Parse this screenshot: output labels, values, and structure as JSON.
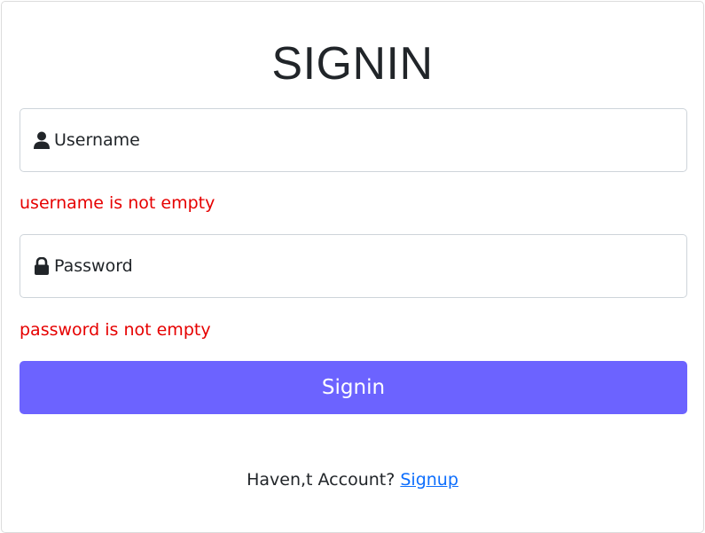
{
  "form": {
    "title": "SIGNIN",
    "username": {
      "icon": "user-icon",
      "placeholder": "Username",
      "value": "",
      "error": "username is not empty"
    },
    "password": {
      "icon": "lock-icon",
      "placeholder": "Password",
      "value": "",
      "error": "password is not empty"
    },
    "submit_label": "Signin",
    "footer_text": "Haven,t Account?",
    "signup_link": "Signup"
  },
  "colors": {
    "button": "#6c63ff",
    "error": "#e60000",
    "link": "#0d6efd"
  }
}
